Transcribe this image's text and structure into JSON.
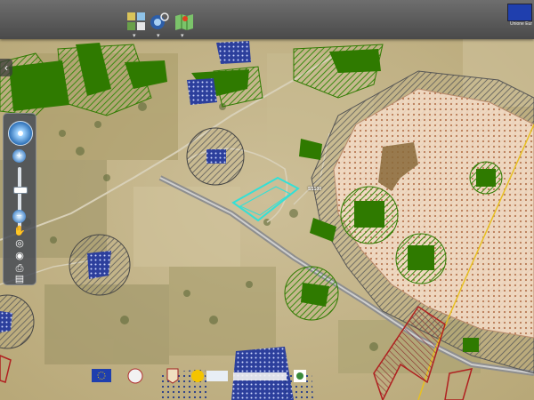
{
  "toolbar": {
    "buttons": [
      {
        "name": "layers-button",
        "icon": "layers-icon"
      },
      {
        "name": "overlay-button",
        "icon": "globe-search-icon"
      },
      {
        "name": "basemap-button",
        "icon": "map-icon"
      }
    ],
    "eu_label": "Unione Eur"
  },
  "nav": {
    "zoom_in": "+",
    "zoom_out": "−",
    "back_arrow": "‹",
    "zoom_level": 0.34
  },
  "map_labels": {
    "road_label": "SS100"
  },
  "colors": {
    "green_area": "#2f7a00",
    "hatch_green": "#3a8a10",
    "blue_area": "#2c3f9c",
    "peach_zone": "#f1d0b6",
    "cyan_outline": "#33e0d6",
    "red_boundary": "#b02020",
    "yellow_line": "#e8c020"
  },
  "footer_logos": [
    "eu-flag-logo",
    "region-seal-logo",
    "province-logo",
    "sun-logo",
    "text-logo",
    "interreg-logo"
  ]
}
